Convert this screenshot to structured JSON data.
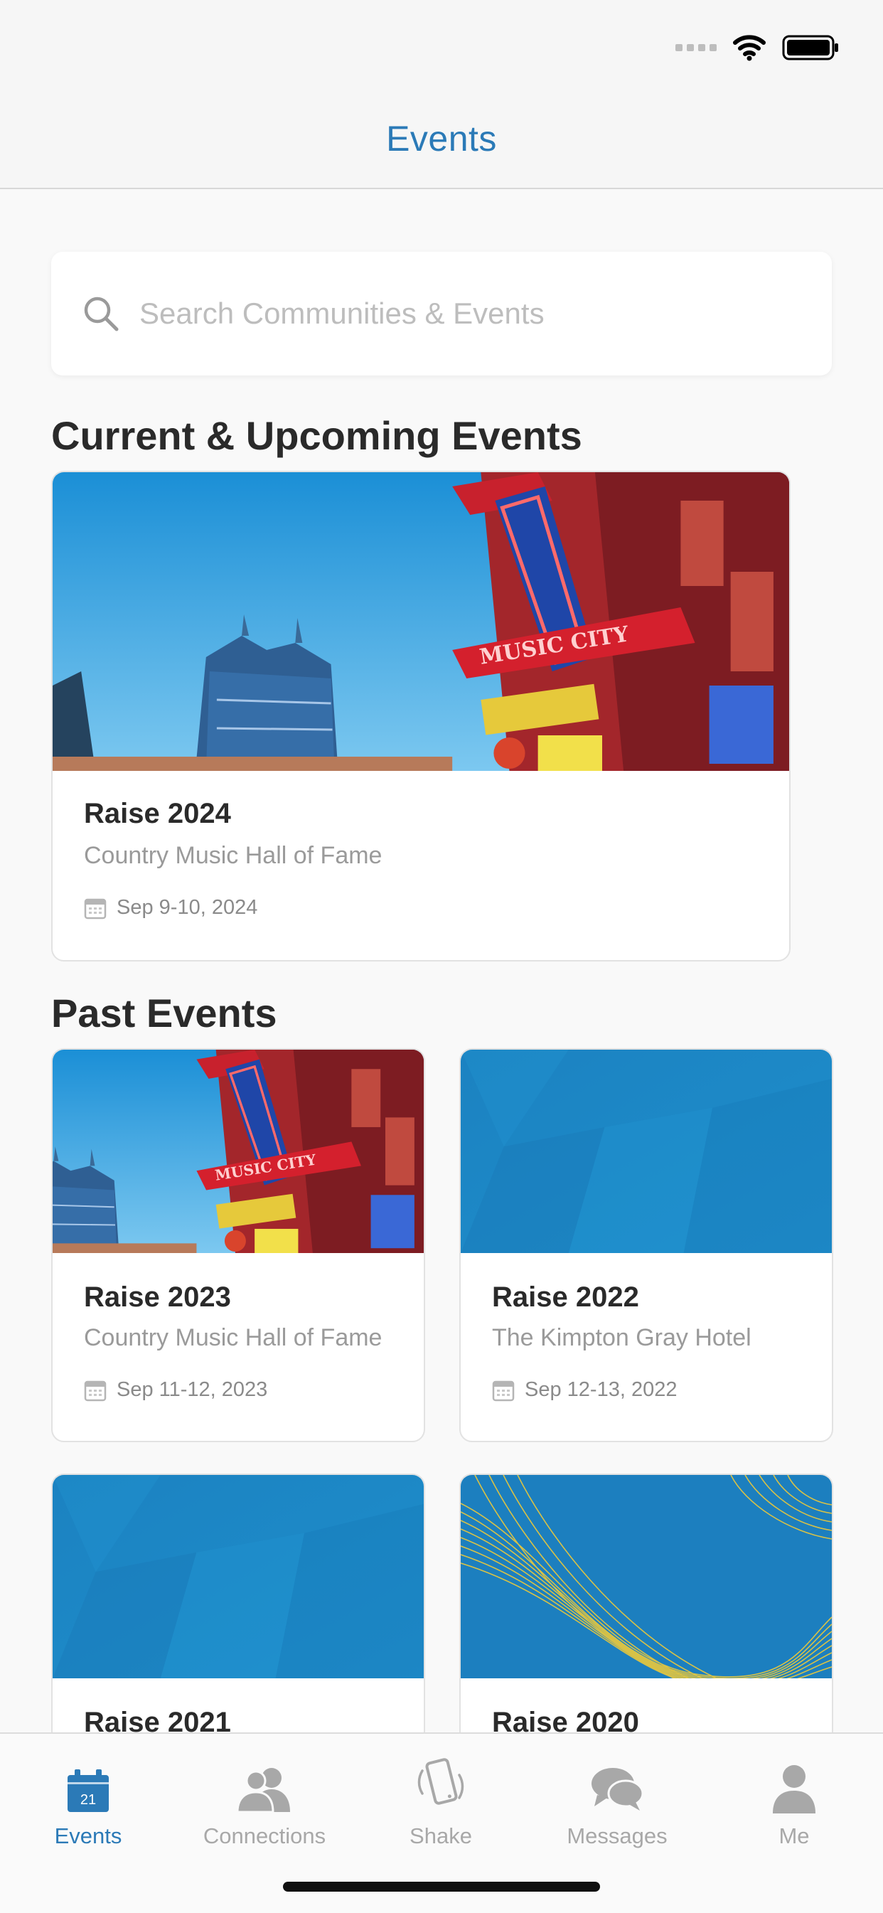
{
  "nav": {
    "title": "Events"
  },
  "search": {
    "placeholder": "Search Communities & Events",
    "value": ""
  },
  "sections": {
    "current": "Current & Upcoming Events",
    "past": "Past Events"
  },
  "current_events": [
    {
      "title": "Raise 2024",
      "venue": "Country Music Hall of Fame",
      "date": "Sep 9-10, 2024",
      "image": "nashville-skyline-neon-signs"
    }
  ],
  "past_events": [
    {
      "title": "Raise 2023",
      "venue": "Country Music Hall of Fame",
      "date": "Sep 11-12, 2023",
      "image": "nashville-skyline-neon-signs"
    },
    {
      "title": "Raise 2022",
      "venue": "The Kimpton Gray Hotel",
      "date": "Sep 12-13, 2022",
      "image": "blue-geometric-pattern"
    },
    {
      "title": "Raise 2021",
      "image": "blue-geometric-pattern"
    },
    {
      "title": "Raise 2020",
      "image": "blue-gold-wave-lines"
    }
  ],
  "tabbar": {
    "items": [
      {
        "label": "Events",
        "icon": "calendar-icon",
        "calendar_day": "21",
        "active": true
      },
      {
        "label": "Connections",
        "icon": "people-icon",
        "active": false
      },
      {
        "label": "Shake",
        "icon": "phone-shake-icon",
        "active": false
      },
      {
        "label": "Messages",
        "icon": "chat-bubbles-icon",
        "active": false
      },
      {
        "label": "Me",
        "icon": "person-icon",
        "active": false
      }
    ]
  },
  "colors": {
    "accent": "#2b7ab7",
    "inactive": "#a8a8a8",
    "banner_blue": "#1e86c4",
    "gold": "#e3c640"
  }
}
